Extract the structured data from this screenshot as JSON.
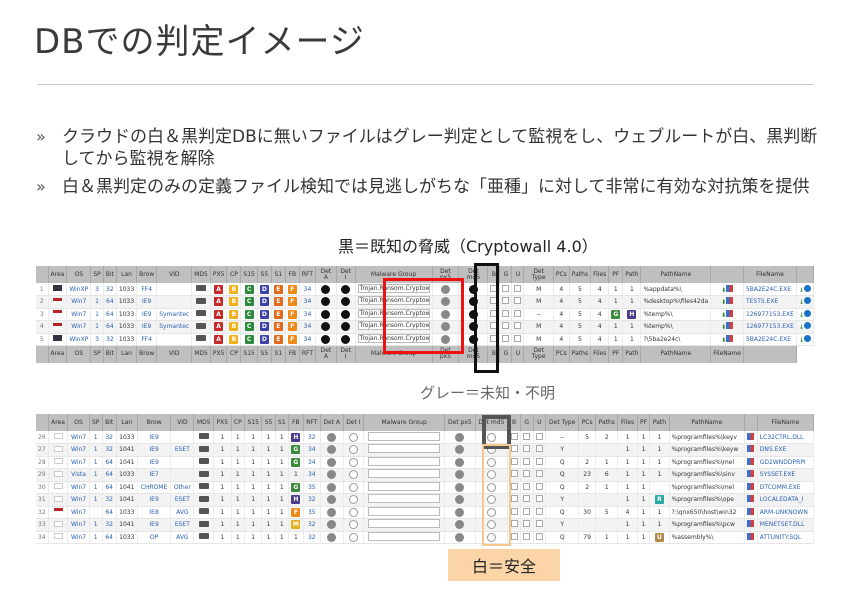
{
  "slide": {
    "title": "DBでの判定イメージ",
    "bullets": [
      "クラウドの白＆黒判定DBに無いファイルはグレー判定として監視をし、ウェブルートが白、黒判断してから監視を解除",
      "白＆黒判定のみの定義ファイル検知では見逃しがちな「亜種」に対して非常に有効な対抗策を提供"
    ],
    "bullet_mark": "»",
    "caption_black": "黒＝既知の脅威（Cryptowall 4.0）",
    "caption_grey": "グレー＝未知・不明",
    "caption_white": "白＝安全"
  },
  "top_table": {
    "headers": [
      "",
      "Area",
      "OS",
      "SP",
      "Bit",
      "Lan",
      "Brow",
      "VID",
      "MD5",
      "PX5",
      "CP",
      "S15",
      "S5",
      "S1",
      "FB",
      "RFT",
      "Det A",
      "Det I",
      "Malware Group",
      "Det px5",
      "Det md5",
      "B",
      "G",
      "U",
      "Det Type",
      "PCs",
      "Paths",
      "Files",
      "PF",
      "Path",
      "PathName",
      "",
      "FileName",
      ""
    ],
    "rows": [
      {
        "n": "1",
        "flag": "eu",
        "os": "WinXP",
        "sp": "3",
        "bit": "32",
        "lan": "1033",
        "brow": "FF4",
        "vid": "",
        "rft": "34",
        "malware": "Trojan.Ransom.Cryptowall",
        "type": "M",
        "pcs": "4",
        "paths": "5",
        "files": "4",
        "pf": "1",
        "path": "1",
        "pathname": "%appdata%\\",
        "filename": "5BA2E24C.EXE",
        "badge": ""
      },
      {
        "n": "2",
        "flag": "us",
        "os": "Win7",
        "sp": "1",
        "bit": "64",
        "lan": "1033",
        "brow": "IE9",
        "vid": "",
        "rft": "34",
        "malware": "Trojan.Ransom.Cryptowall",
        "type": "M",
        "pcs": "4",
        "paths": "5",
        "files": "4",
        "pf": "1",
        "path": "1",
        "pathname": "%desktop%\\files42da",
        "filename": "TESTS.EXE",
        "badge": ""
      },
      {
        "n": "3",
        "flag": "us",
        "os": "Win7",
        "sp": "1",
        "bit": "64",
        "lan": "1033",
        "brow": "IE9",
        "vid": "Symantec",
        "rft": "34",
        "malware": "Trojan.Ransom.Cryptowall",
        "type": "--",
        "pcs": "4",
        "paths": "5",
        "files": "4",
        "pf": "G",
        "path": "H",
        "pathname": "%temp%\\",
        "filename": "126977153.EXE",
        "badge": "GH"
      },
      {
        "n": "4",
        "flag": "us",
        "os": "Win7",
        "sp": "1",
        "bit": "64",
        "lan": "1033",
        "brow": "IE9",
        "vid": "Symantec",
        "rft": "34",
        "malware": "Trojan.Ransom.Cryptowall",
        "type": "M",
        "pcs": "4",
        "paths": "5",
        "files": "4",
        "pf": "1",
        "path": "1",
        "pathname": "%temp%\\",
        "filename": "126977153.EXE",
        "badge": ""
      },
      {
        "n": "5",
        "flag": "eu",
        "os": "WinXP",
        "sp": "3",
        "bit": "32",
        "lan": "1033",
        "brow": "FF4",
        "vid": "",
        "rft": "34",
        "malware": "Trojan.Ransom.Cryptowall",
        "type": "M",
        "pcs": "4",
        "paths": "5",
        "files": "4",
        "pf": "1",
        "path": "1",
        "pathname": "?\\5ba2e24c\\",
        "filename": "5BA2E24C.EXE",
        "badge": ""
      }
    ],
    "footer": [
      "Area",
      "OS",
      "SP",
      "Bit",
      "Lan",
      "Brow",
      "VID",
      "MD5",
      "PX5",
      "CP",
      "S15",
      "S5",
      "S1",
      "FB",
      "RFT",
      "Det A",
      "Det I",
      "Malware Group",
      "Det px5",
      "Det md5",
      "B",
      "G",
      "U",
      "Det Type",
      "PCs",
      "Paths",
      "Files",
      "PF",
      "Path",
      "PathName",
      "FileName"
    ]
  },
  "bottom_table": {
    "headers": [
      "",
      "Area",
      "OS",
      "SP",
      "Bit",
      "Lan",
      "Brow",
      "VID",
      "MD5",
      "PX5",
      "CP",
      "S15",
      "S5",
      "S1",
      "FB",
      "RFT",
      "Det A",
      "Det I",
      "Malware Group",
      "Det px5",
      "Det md5",
      "B",
      "G",
      "U",
      "Det Type",
      "PCs",
      "Paths",
      "Files",
      "PF",
      "Path",
      "PathName",
      "",
      "FileName"
    ],
    "rows": [
      {
        "n": "26",
        "flag": "jp",
        "os": "Win7",
        "sp": "1",
        "bit": "32",
        "lan": "1033",
        "brow": "IE9",
        "vid": "",
        "fb": "H",
        "rft": "32",
        "type": "--",
        "pcs": "5",
        "paths": "2",
        "files": "1",
        "pf": "1",
        "path": "1",
        "pathname": "%programfiles%\\keyv",
        "filename": "LC32CTRL.DLL"
      },
      {
        "n": "27",
        "flag": "jp",
        "os": "Win7",
        "sp": "1",
        "bit": "32",
        "lan": "1041",
        "brow": "IE9",
        "vid": "ESET",
        "fb": "G",
        "rft": "34",
        "type": "Y",
        "pcs": "",
        "paths": "",
        "files": "1",
        "pf": "1",
        "path": "1",
        "pathname": "%programfiles%\\keyw",
        "filename": "DNS.EXE"
      },
      {
        "n": "28",
        "flag": "jp",
        "os": "Win7",
        "sp": "1",
        "bit": "64",
        "lan": "1041",
        "brow": "IE9",
        "vid": "",
        "fb": "G",
        "rft": "34",
        "type": "Q",
        "pcs": "2",
        "paths": "1",
        "files": "1",
        "pf": "1",
        "path": "1",
        "pathname": "%programfiles%\\mel",
        "filename": "GD2WNDDPRPI"
      },
      {
        "n": "29",
        "flag": "jp",
        "os": "Vista",
        "sp": "1",
        "bit": "64",
        "lan": "1033",
        "brow": "IE7",
        "vid": "",
        "fb": "1",
        "rft": "34",
        "type": "Q",
        "pcs": "23",
        "paths": "6",
        "files": "1",
        "pf": "1",
        "path": "1",
        "pathname": "%programfiles%\\sinv",
        "filename": "SYSSET.EXE"
      },
      {
        "n": "30",
        "flag": "jp",
        "os": "Win7",
        "sp": "1",
        "bit": "64",
        "lan": "1041",
        "brow": "CHROME",
        "vid": "Other",
        "fb": "G",
        "rft": "35",
        "type": "Q",
        "pcs": "2",
        "paths": "1",
        "files": "1",
        "pf": "1",
        "path": "T",
        "pathname": "%programfiles%\\mel",
        "filename": "DTCOMM.EXE"
      },
      {
        "n": "31",
        "flag": "jp",
        "os": "Win7",
        "sp": "1",
        "bit": "32",
        "lan": "1041",
        "brow": "IE9",
        "vid": "ESET",
        "fb": "H",
        "rft": "32",
        "type": "Y",
        "pcs": "",
        "paths": "",
        "files": "1",
        "pf": "1",
        "path": "R",
        "pathname": "%programfiles%\\ope",
        "filename": "LOCALEDATA_I"
      },
      {
        "n": "32",
        "flag": "us",
        "os": "Win7",
        "sp": "",
        "bit": "64",
        "lan": "1033",
        "brow": "IE8",
        "vid": "AVG",
        "fb": "F",
        "rft": "35",
        "type": "Q",
        "pcs": "30",
        "paths": "5",
        "files": "4",
        "pf": "1",
        "path": "1",
        "pathname": "?:\\qnx650\\host\\win32",
        "filename": "ARM-UNKNOWN"
      },
      {
        "n": "33",
        "flag": "jp",
        "os": "Win7",
        "sp": "1",
        "bit": "32",
        "lan": "1041",
        "brow": "IE9",
        "vid": "ESET",
        "fb": "M",
        "rft": "32",
        "type": "Y",
        "pcs": "",
        "paths": "",
        "files": "1",
        "pf": "1",
        "path": "1",
        "pathname": "%programfiles%\\pcw",
        "filename": "MENETSET.DLL"
      },
      {
        "n": "34",
        "flag": "jp",
        "os": "Win7",
        "sp": "1",
        "bit": "64",
        "lan": "1033",
        "brow": "OP",
        "vid": "AVG",
        "fb": "1",
        "rft": "32",
        "type": "Q",
        "pcs": "79",
        "paths": "1",
        "files": "1",
        "pf": "1",
        "path": "U",
        "pathname": "%assembly%\\",
        "filename": "ATTUNITY.SQL"
      }
    ]
  },
  "colors": {
    "red_highlight": "#e11111",
    "black_highlight": "#111111",
    "grey_highlight": "#555555",
    "white_label_bg": "#fbd5a7"
  }
}
